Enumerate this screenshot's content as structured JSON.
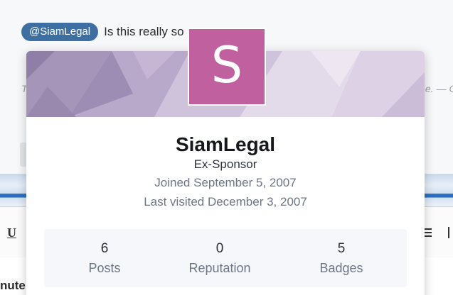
{
  "background": {
    "mention_tag": "@SiamLegal",
    "mention_text": "Is this really so",
    "faded_left": "T",
    "faded_right": "e. — G",
    "toolbar_underline": "U",
    "footer_label": "nute"
  },
  "profile_card": {
    "avatar_letter": "S",
    "avatar_color": "#c0609f",
    "name": "SiamLegal",
    "title": "Ex-Sponsor",
    "joined": "Joined September 5, 2007",
    "last_visited": "Last visited December 3, 2007",
    "stats": [
      {
        "value": "6",
        "label": "Posts"
      },
      {
        "value": "0",
        "label": "Reputation"
      },
      {
        "value": "5",
        "label": "Badges"
      }
    ]
  },
  "colors": {
    "mention_pill": "#3e6fa3",
    "toolbar_accent": "#2a6fc2"
  }
}
